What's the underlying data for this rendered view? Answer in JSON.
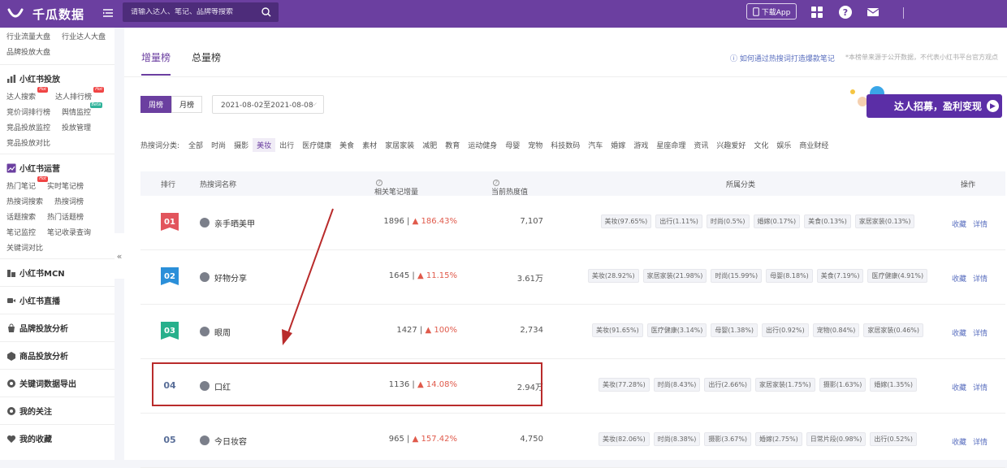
{
  "topbar": {
    "app_name": "千瓜数据",
    "search_placeholder": "请输入达人、笔记、品牌等搜索",
    "download_label": "下载App"
  },
  "sidebar": {
    "top_links": [
      "行业流量大盘",
      "行业达人大盘",
      "品牌投放大盘"
    ],
    "sections": [
      {
        "title": "小红书投放",
        "links": [
          {
            "label": "达人搜索",
            "badge": "Hot"
          },
          {
            "label": "达人排行榜",
            "badge": "Hot"
          },
          {
            "label": "竞价词排行榜",
            "badge": ""
          },
          {
            "label": "舆情监控",
            "badge": "Beta"
          },
          {
            "label": "竞品投放监控",
            "badge": ""
          },
          {
            "label": "投放管理",
            "badge": ""
          },
          {
            "label": "竞品投放对比",
            "badge": ""
          }
        ]
      },
      {
        "title": "小红书运营",
        "links": [
          {
            "label": "热门笔记",
            "badge": "Hot"
          },
          {
            "label": "实时笔记榜",
            "badge": ""
          },
          {
            "label": "热搜词搜索",
            "badge": ""
          },
          {
            "label": "热搜词榜",
            "badge": ""
          },
          {
            "label": "话题搜索",
            "badge": ""
          },
          {
            "label": "热门话题榜",
            "badge": ""
          },
          {
            "label": "笔记监控",
            "badge": ""
          },
          {
            "label": "笔记收录查询",
            "badge": ""
          },
          {
            "label": "关键词对比",
            "badge": ""
          }
        ]
      }
    ],
    "singles": [
      "小红书MCN",
      "小红书直播",
      "品牌投放分析",
      "商品投放分析",
      "关键词数据导出",
      "我的关注",
      "我的收藏"
    ],
    "collapse_glyph": "«"
  },
  "main": {
    "tabs": [
      "增量榜",
      "总量榜"
    ],
    "help_link": "如何通过热搜词打造爆款笔记",
    "note": "*本榜单来源于公开数据，不代表小红书平台官方观点",
    "period_options": [
      "周榜",
      "月榜"
    ],
    "date_range": "2021-08-02至2021-08-08",
    "banner_text": "达人招募，盈利变现",
    "category_label": "热搜词分类:",
    "categories": [
      "全部",
      "时尚",
      "摄影",
      "美妆",
      "出行",
      "医疗健康",
      "美食",
      "素材",
      "家居家装",
      "减肥",
      "教育",
      "运动健身",
      "母婴",
      "宠物",
      "科技数码",
      "汽车",
      "婚嫁",
      "游戏",
      "星座命理",
      "资讯",
      "兴趣爱好",
      "文化",
      "娱乐",
      "商业财经"
    ],
    "active_category": "美妆",
    "table": {
      "headers": {
        "rank": "排行",
        "keyword": "热搜词名称",
        "notes": "相关笔记增量",
        "heat": "当前热度值",
        "category": "所属分类",
        "ops": "操作"
      },
      "rows": [
        {
          "rank": "01",
          "keyword": "亲手晒美甲",
          "notes": "1896 |",
          "growth": "186.43%",
          "heat": "7,107",
          "tags": [
            "美妆(97.65%)",
            "出行(1.11%)",
            "时尚(0.5%)",
            "婚嫁(0.17%)",
            "美食(0.13%)",
            "家居家装(0.13%)"
          ]
        },
        {
          "rank": "02",
          "keyword": "好物分享",
          "notes": "1645 |",
          "growth": "11.15%",
          "heat": "3.61万",
          "tags": [
            "美妆(28.92%)",
            "家居家装(21.98%)",
            "时尚(15.99%)",
            "母婴(8.18%)",
            "美食(7.19%)",
            "医疗健康(4.91%)"
          ]
        },
        {
          "rank": "03",
          "keyword": "眼周",
          "notes": "1427 |",
          "growth": "100%",
          "heat": "2,734",
          "tags": [
            "美妆(91.65%)",
            "医疗健康(3.14%)",
            "母婴(1.38%)",
            "出行(0.92%)",
            "宠物(0.84%)",
            "家居家装(0.46%)"
          ]
        },
        {
          "rank": "04",
          "keyword": "口红",
          "notes": "1136 |",
          "growth": "14.08%",
          "heat": "2.94万",
          "tags": [
            "美妆(77.28%)",
            "时尚(8.43%)",
            "出行(2.66%)",
            "家居家装(1.75%)",
            "摄影(1.63%)",
            "婚嫁(1.35%)"
          ]
        },
        {
          "rank": "05",
          "keyword": "今日妆容",
          "notes": "965 |",
          "growth": "157.42%",
          "heat": "4,750",
          "tags": [
            "美妆(82.06%)",
            "时尚(8.38%)",
            "摄影(3.67%)",
            "婚嫁(2.75%)",
            "日常片段(0.98%)",
            "出行(0.52%)"
          ]
        }
      ],
      "row_actions": [
        "收藏",
        "详情"
      ]
    }
  },
  "colors": {
    "brand": "#6b3fa0",
    "rank1": "#e2545c",
    "rank2": "#2b8fd9",
    "rank3": "#27b08c",
    "highlight": "#b92b2b"
  }
}
